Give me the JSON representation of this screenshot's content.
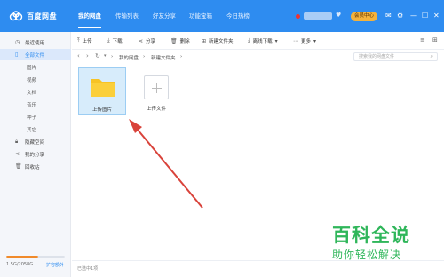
{
  "app": {
    "title": "百度网盘"
  },
  "top_tabs": [
    {
      "label": "我的网盘",
      "active": true
    },
    {
      "label": "传输列表"
    },
    {
      "label": "好友分享"
    },
    {
      "label": "功能宝箱"
    },
    {
      "label": "今日热榜"
    }
  ],
  "user": {
    "vip_label": "会员中心"
  },
  "toolbar": {
    "upload": "上传",
    "download": "下载",
    "share": "分享",
    "delete": "删除",
    "new_folder": "新建文件夹",
    "offline": "离线下载",
    "more": "更多"
  },
  "breadcrumb": [
    "我的网盘",
    "新建文件夹"
  ],
  "search": {
    "placeholder": "搜索我的网盘文件"
  },
  "sidebar": {
    "items": [
      {
        "label": "最近使用",
        "icon": "clock-icon"
      },
      {
        "label": "全部文件",
        "icon": "file-icon",
        "active": true
      },
      {
        "label": "图片"
      },
      {
        "label": "视频"
      },
      {
        "label": "文档"
      },
      {
        "label": "音乐"
      },
      {
        "label": "种子"
      },
      {
        "label": "其它"
      },
      {
        "label": "隐藏空间",
        "icon": "lock-icon"
      },
      {
        "label": "我的分享",
        "icon": "share-icon"
      },
      {
        "label": "回收站",
        "icon": "trash-icon"
      }
    ],
    "quota_text": "1.5G/2058G",
    "quota_fraction": 0.55,
    "expand_label": "扩容额外"
  },
  "files": [
    {
      "name": "上传图片",
      "type": "folder",
      "selected": true
    },
    {
      "name": "上传文件",
      "type": "upload"
    }
  ],
  "status": {
    "text": "已选中1项"
  },
  "colors": {
    "accent": "#2e8cf0",
    "folder": "#f7c325",
    "arrow": "#d9433b",
    "watermark": "#2fb65a"
  },
  "watermark": {
    "title": "百科全说",
    "subtitle": "助你轻松解决"
  }
}
